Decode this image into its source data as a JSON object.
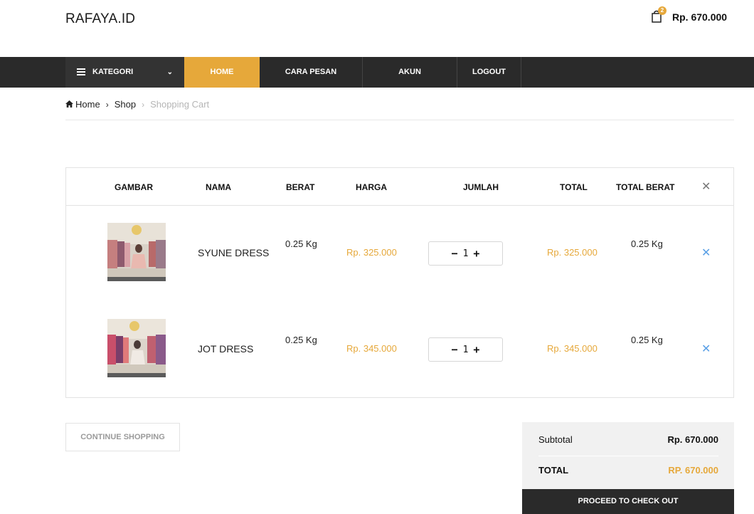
{
  "header": {
    "logo": "RAFAYA.ID",
    "cart_badge": "2",
    "cart_total": "Rp. 670.000"
  },
  "nav": {
    "kategori": "KATEGORI",
    "home": "HOME",
    "cara_pesan": "CARA PESAN",
    "akun": "AKUN",
    "logout": "LOGOUT"
  },
  "breadcrumb": {
    "home": "Home",
    "shop": "Shop",
    "current": "Shopping Cart"
  },
  "table": {
    "headers": {
      "gambar": "GAMBAR",
      "nama": "NAMA",
      "berat": "BERAT",
      "harga": "HARGA",
      "jumlah": "JUMLAH",
      "total": "TOTAL",
      "total_berat": "TOTAL BERAT"
    },
    "rows": [
      {
        "nama": "SYUNE DRESS",
        "berat": "0.25 Kg",
        "harga": "Rp. 325.000",
        "jumlah": "1",
        "total": "Rp. 325.000",
        "total_berat": "0.25 Kg"
      },
      {
        "nama": "JOT DRESS",
        "berat": "0.25 Kg",
        "harga": "Rp. 345.000",
        "jumlah": "1",
        "total": "Rp. 345.000",
        "total_berat": "0.25 Kg"
      }
    ]
  },
  "actions": {
    "continue": "CONTINUE SHOPPING",
    "checkout": "PROCEED TO CHECK OUT"
  },
  "totals": {
    "subtotal_label": "Subtotal",
    "subtotal_value": "Rp. 670.000",
    "total_label": "TOTAL",
    "total_value": "RP. 670.000"
  },
  "icons": {
    "menu": "menu-icon",
    "chevron": "chevron-down-icon",
    "home": "home-icon",
    "cart": "cart-icon",
    "remove": "close-icon",
    "plus": "plus-icon",
    "minus": "minus-icon"
  },
  "colors": {
    "accent": "#e6a83a",
    "nav_bg": "#2a2a2a",
    "remove_blue": "#5aa0e6"
  }
}
